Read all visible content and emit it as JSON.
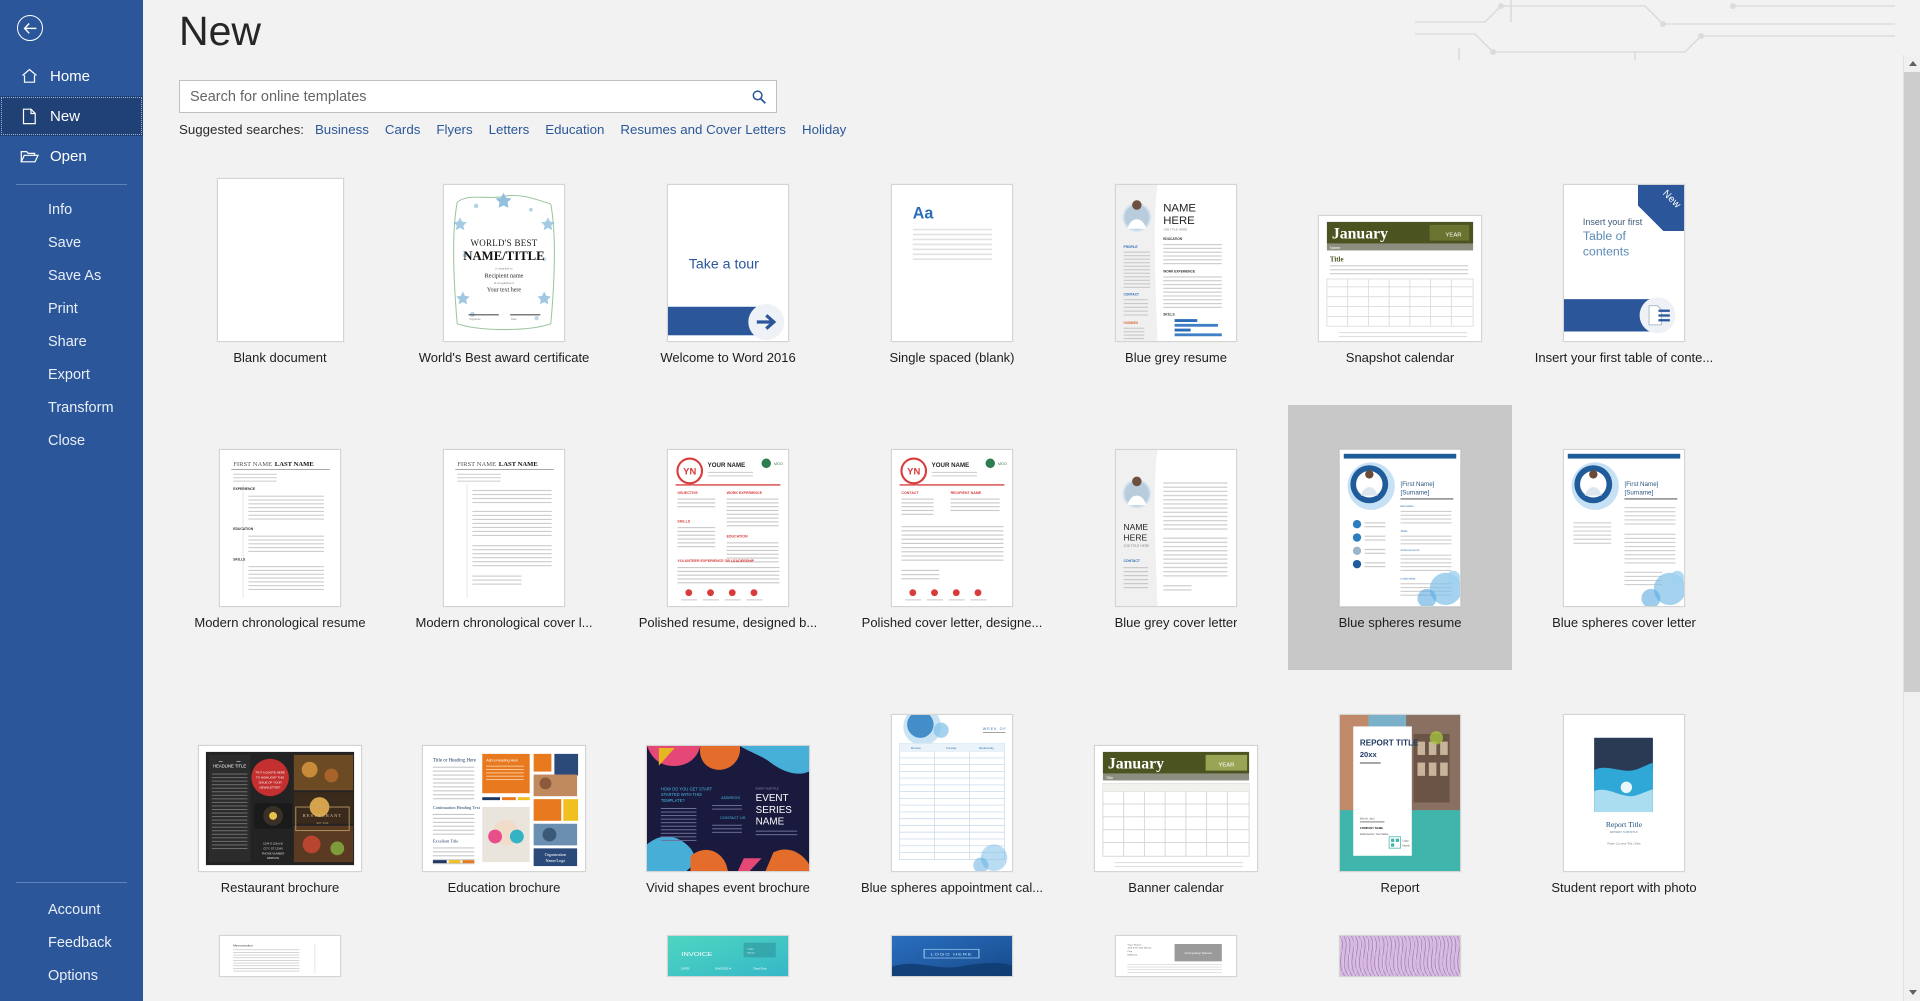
{
  "sidebar": {
    "back_label": "Back",
    "primary": [
      {
        "label": "Home",
        "icon": "home-icon",
        "selected": false
      },
      {
        "label": "New",
        "icon": "new-document-icon",
        "selected": true
      },
      {
        "label": "Open",
        "icon": "open-folder-icon",
        "selected": false
      }
    ],
    "secondary": [
      {
        "label": "Info"
      },
      {
        "label": "Save"
      },
      {
        "label": "Save As"
      },
      {
        "label": "Print"
      },
      {
        "label": "Share"
      },
      {
        "label": "Export"
      },
      {
        "label": "Transform"
      },
      {
        "label": "Close"
      }
    ],
    "bottom": [
      {
        "label": "Account"
      },
      {
        "label": "Feedback"
      },
      {
        "label": "Options"
      }
    ],
    "background_color": "#2b579a",
    "selected_color": "#204175"
  },
  "header": {
    "title": "New"
  },
  "search": {
    "value": "",
    "placeholder": "Search for online templates",
    "icon": "search-icon"
  },
  "suggested": {
    "label": "Suggested searches:",
    "links": [
      "Business",
      "Cards",
      "Flyers",
      "Letters",
      "Education",
      "Resumes and Cover Letters",
      "Holiday"
    ],
    "link_color": "#2b579a"
  },
  "templates": {
    "row1": [
      {
        "caption": "Blank document",
        "kind": "blank",
        "selected": false,
        "badge": ""
      },
      {
        "caption": "World's Best award certificate",
        "kind": "certificate",
        "selected": false,
        "badge": "",
        "text": {
          "line1": "WORLD'S BEST",
          "line2": "NAME/TITLE",
          "line3": "Recipient name",
          "line4": "Your text here"
        }
      },
      {
        "caption": "Welcome to Word 2016",
        "kind": "tour",
        "selected": false,
        "badge": "",
        "text": {
          "line1": "Take a tour"
        }
      },
      {
        "caption": "Single spaced (blank)",
        "kind": "single-spaced",
        "selected": false,
        "badge": "",
        "text": {
          "line1": "Aa"
        }
      },
      {
        "caption": "Blue grey resume",
        "kind": "bluegrey-resume",
        "selected": false,
        "badge": "",
        "text": {
          "line1": "NAME",
          "line2": "HERE",
          "line3": "JOB TITLE HERE"
        }
      },
      {
        "caption": "Snapshot calendar",
        "kind": "snapshot-calendar",
        "selected": false,
        "badge": "",
        "text": {
          "line1": "January",
          "line2": "YEAR",
          "line3": "Title"
        }
      },
      {
        "caption": "Insert your first table of conte...",
        "kind": "toc",
        "selected": false,
        "badge": "New",
        "text": {
          "line1": "Insert your first",
          "line2": "Table of",
          "line3": "contents"
        }
      }
    ],
    "row2": [
      {
        "caption": "Modern chronological resume",
        "kind": "modern-resume",
        "selected": false,
        "badge": "",
        "text": {
          "line1": "FIRST NAME",
          "line2": "LAST NAME"
        }
      },
      {
        "caption": "Modern chronological cover l...",
        "kind": "modern-cover",
        "selected": false,
        "badge": "",
        "text": {
          "line1": "FIRST NAME",
          "line2": "LAST NAME"
        }
      },
      {
        "caption": "Polished resume, designed b...",
        "kind": "polished-resume",
        "selected": false,
        "badge": "",
        "text": {
          "line1": "YN",
          "line2": "YOUR NAME",
          "line3": "MOO"
        }
      },
      {
        "caption": "Polished cover letter, designe...",
        "kind": "polished-cover",
        "selected": false,
        "badge": "",
        "text": {
          "line1": "YN",
          "line2": "YOUR NAME",
          "line3": "MOO"
        }
      },
      {
        "caption": "Blue grey cover letter",
        "kind": "bluegrey-cover",
        "selected": false,
        "badge": "",
        "text": {
          "line1": "NAME",
          "line2": "HERE",
          "line3": "JOB TITLE HERE"
        }
      },
      {
        "caption": "Blue spheres resume",
        "kind": "spheres-resume",
        "selected": true,
        "badge": "",
        "text": {
          "line1": "[First Name]",
          "line2": "[Surname]"
        }
      },
      {
        "caption": "Blue spheres cover letter",
        "kind": "spheres-cover",
        "selected": false,
        "badge": "",
        "text": {
          "line1": "[First Name]",
          "line2": "[Surname]"
        }
      }
    ],
    "row3": [
      {
        "caption": "Restaurant brochure",
        "kind": "restaurant-brochure",
        "selected": false,
        "badge": "",
        "text": {
          "line1": "HEADLINE TITLE",
          "line2": "\"PUT A QUOTE HERE TO HIGHLIGHT THIS ISSUE OF YOUR NEWSLETTER\"",
          "line3": "RESTAURANT"
        }
      },
      {
        "caption": "Education brochure",
        "kind": "education-brochure",
        "selected": false,
        "badge": "",
        "text": {
          "line1": "Title or Heading Here",
          "line2": "Add a Heading Here",
          "line3": "Organization Name/Logo"
        }
      },
      {
        "caption": "Vivid shapes event brochure",
        "kind": "vivid-brochure",
        "selected": false,
        "badge": "",
        "text": {
          "line1": "HOW DO YOU GET STARTED WITH THIS TEMPLATE?",
          "line2": "ADDRESS",
          "line3": "CONTACT US",
          "line4": "EVENT SERIES NAME"
        }
      },
      {
        "caption": "Blue spheres appointment cal...",
        "kind": "appointment-calendar",
        "selected": false,
        "badge": "",
        "text": {
          "line1": "WEEK OF"
        }
      },
      {
        "caption": "Banner calendar",
        "kind": "banner-calendar",
        "selected": false,
        "badge": "",
        "text": {
          "line1": "January",
          "line2": "YEAR",
          "line3": "Title"
        }
      },
      {
        "caption": "Report",
        "kind": "report",
        "selected": false,
        "badge": "",
        "text": {
          "line1": "REPORT TITLE",
          "line2": "20xx",
          "line3": "COMPANY NAME",
          "line4": "Authored by: Your Name",
          "line5": "Logo Name"
        }
      },
      {
        "caption": "Student report with photo",
        "kind": "student-report",
        "selected": false,
        "badge": "",
        "text": {
          "line1": "Report Title",
          "line2": "REPORT SUBTITLE",
          "line3": "Paper | Course Title | Date"
        }
      }
    ],
    "row4": [
      {
        "caption": "",
        "kind": "partial-doc",
        "selected": false,
        "badge": ""
      },
      {
        "caption": "",
        "kind": "partial-empty",
        "selected": false,
        "badge": ""
      },
      {
        "caption": "",
        "kind": "partial-invoice",
        "selected": false,
        "badge": "",
        "text": {
          "line1": "INVOICE"
        }
      },
      {
        "caption": "",
        "kind": "partial-logo",
        "selected": false,
        "badge": "",
        "text": {
          "line1": "LOGO HERE"
        }
      },
      {
        "caption": "",
        "kind": "partial-company",
        "selected": false,
        "badge": "",
        "text": {
          "line1": "Company Name"
        }
      },
      {
        "caption": "",
        "kind": "partial-texture",
        "selected": false,
        "badge": ""
      },
      {
        "caption": "",
        "kind": "partial-empty",
        "selected": false,
        "badge": ""
      }
    ]
  },
  "scrollbar": {
    "up_icon": "scroll-up-arrow-icon",
    "down_icon": "scroll-down-arrow-icon"
  }
}
